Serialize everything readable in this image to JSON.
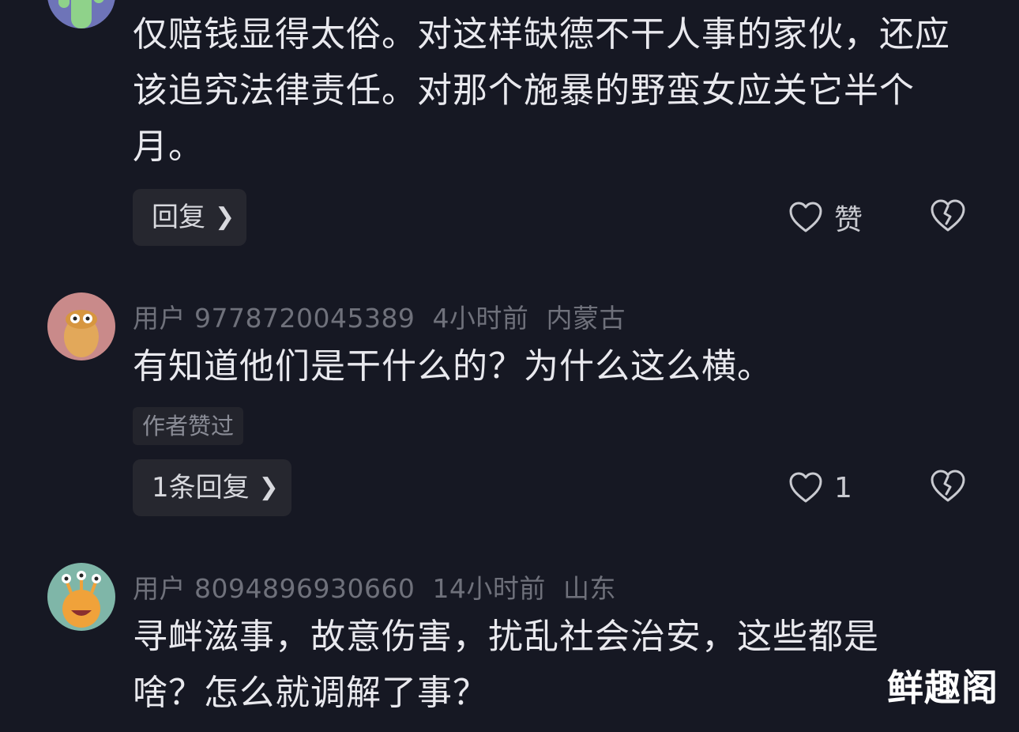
{
  "comments": [
    {
      "text": "仅赔钱显得太俗。对这样缺德不干人事的家伙，还应该追究法律责任。对那个施暴的野蛮女应关它半个月。",
      "reply_label": "回复",
      "like_label": "赞"
    },
    {
      "username": "用户 9778720045389",
      "time": "4小时前",
      "location": "内蒙古",
      "text": "有知道他们是干什么的？为什么这么横。",
      "author_liked": "作者赞过",
      "reply_label": "1条回复",
      "like_label": "1"
    },
    {
      "username": "用户 8094896930660",
      "time": "14小时前",
      "location": "山东",
      "text": "寻衅滋事，故意伤害，扰乱社会治安，这些都是啥？怎么就调解了事？"
    }
  ],
  "icons": {
    "like": "heart-outline-icon",
    "dislike": "broken-heart-icon",
    "chevron": "chevron-right-icon"
  },
  "watermark": "鲜趣阁",
  "colors": {
    "background": "#161823",
    "meta": "#6f717b",
    "pill": "#26272f"
  }
}
